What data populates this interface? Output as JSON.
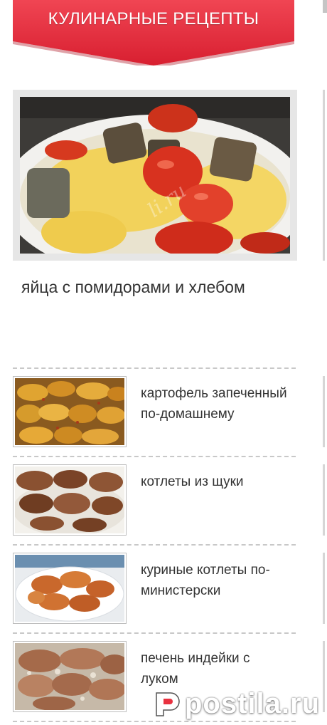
{
  "header": {
    "title": "КУЛИНАРНЫЕ РЕЦЕПТЫ",
    "ribbon_color": "#e8313f"
  },
  "featured": {
    "title": "яйца с помидорами и хлебом",
    "image_watermark": "li.ru"
  },
  "recipes": [
    {
      "title": "картофель запеченный по-домашнему"
    },
    {
      "title": "котлеты из щуки"
    },
    {
      "title": "куриные котлеты по-министерски"
    },
    {
      "title": "печень индейки с луком"
    }
  ],
  "watermark": {
    "text": "postila.ru",
    "icon": "postila-logo-icon"
  }
}
